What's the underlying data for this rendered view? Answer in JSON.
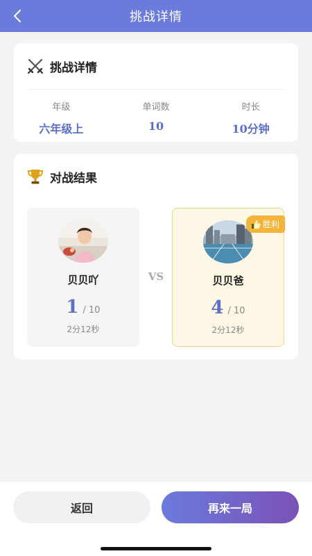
{
  "nav": {
    "title": "挑战详情",
    "back_icon": "chevron-left-icon"
  },
  "info_card": {
    "title": "挑战详情",
    "icon": "crossed-swords-icon",
    "stats": [
      {
        "label": "年级",
        "value": "六年级上"
      },
      {
        "label": "单词数",
        "value": "10"
      },
      {
        "label": "时长",
        "value": "10分钟"
      }
    ]
  },
  "result_card": {
    "title": "对战结果",
    "icon": "trophy-icon",
    "vs": "VS",
    "players": [
      {
        "name": "贝贝吖",
        "score": "1",
        "total": "/ 10",
        "time": "2分12秒",
        "winner": false
      },
      {
        "name": "贝贝爸",
        "score": "4",
        "total": "/ 10",
        "time": "2分12秒",
        "winner": true,
        "badge": "胜利"
      }
    ]
  },
  "actions": {
    "back_label": "返回",
    "again_label": "再来一局"
  },
  "colors": {
    "primary": "#6a7bdc",
    "value": "#5b6fc9",
    "winner_bg": "#fdf8e6",
    "badge": "#f4b43a"
  }
}
